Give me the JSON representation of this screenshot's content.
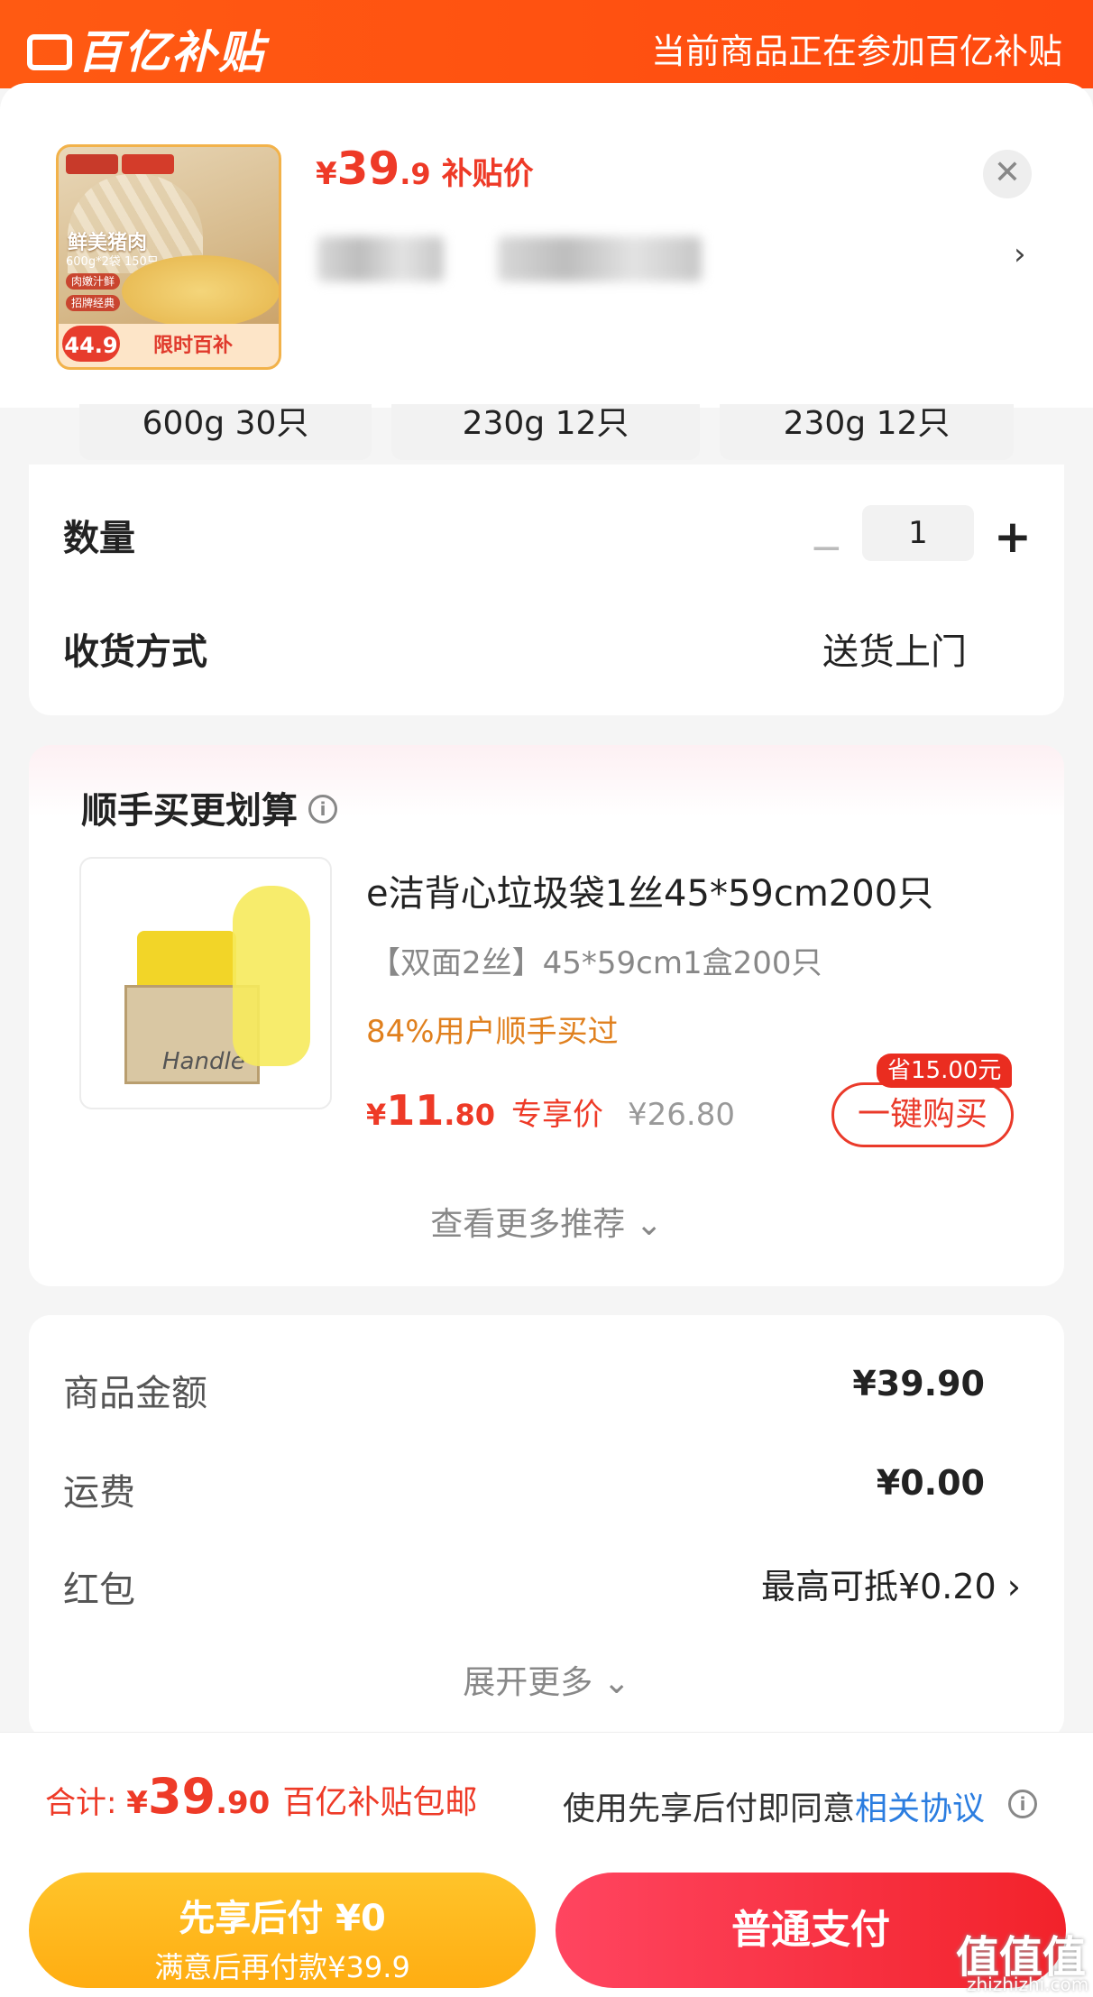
{
  "header": {
    "brand": "百亿补贴",
    "notice": "当前商品正在参加百亿补贴"
  },
  "product": {
    "price_currency": "¥",
    "price_int": "39",
    "price_dec": ".9",
    "price_label": "补贴价",
    "thumb": {
      "main": "鲜美猪肉",
      "sub": "600g*2袋 150只",
      "tag_a": "肉嫩汁鲜",
      "tag_b": "招牌经典",
      "price_badge": "44.9",
      "promo": "限时百补"
    }
  },
  "specs": [
    "600g 30只",
    "230g 12只",
    "230g 12只"
  ],
  "order": {
    "qty_label": "数量",
    "qty_value": "1",
    "minus": "−",
    "plus": "+",
    "delivery_label": "收货方式",
    "delivery_value": "送货上门"
  },
  "recommend": {
    "heading": "顺手买更划算",
    "info_glyph": "i",
    "item": {
      "title": "e洁背心垃圾袋1丝45*59cm200只",
      "spec": "【双面2丝】45*59cm1盒200只",
      "users": "84%用户顺手买过",
      "price_currency": "¥",
      "price_int": "11",
      "price_dec": ".80",
      "price_label": "专享价",
      "original_price": "¥26.80",
      "save_tag": "省15.00元",
      "buy_label": "一键购买",
      "image_text": "Handle"
    },
    "more": "查看更多推荐 ⌄"
  },
  "summary": {
    "goods_label": "商品金额",
    "goods_value": "¥39.90",
    "shipping_label": "运费",
    "shipping_value": "¥0.00",
    "redpacket_label": "红包",
    "redpacket_value": "最高可抵¥0.20 ›",
    "expand": "展开更多 ⌄"
  },
  "footer": {
    "total_label": "合计: ",
    "total_currency": "¥",
    "total_int": "39",
    "total_dec": ".90",
    "total_note": "百亿补贴包邮",
    "agree_prefix": "使用先享后付即同意",
    "agree_link": "相关协议",
    "bnpl_line1": "先享后付 ¥0",
    "bnpl_line2": "满意后再付款¥39.9",
    "pay_label": "普通支付"
  },
  "watermark": {
    "main": "值值值",
    "sub": "zhizhizhi.com"
  },
  "colors": {
    "brand_orange": "#ff5a12",
    "price_red": "#ee3a27",
    "bnpl_yellow": "#ffb31a",
    "pay_red": "#f2222a",
    "link_blue": "#2b7de0"
  },
  "icons": {
    "close": "close-icon",
    "chevron_right": "chevron-right-icon",
    "info": "info-icon"
  }
}
